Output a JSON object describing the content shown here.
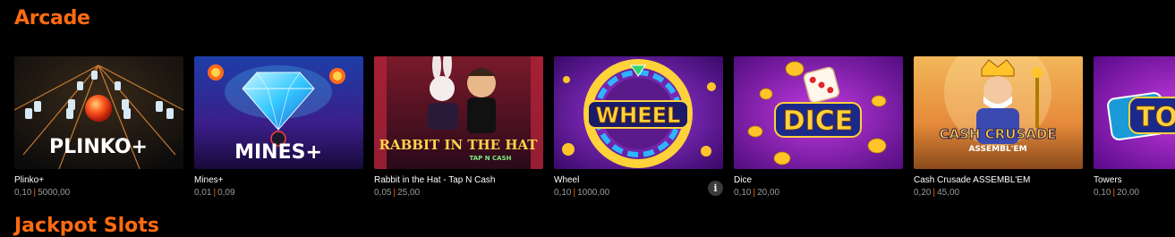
{
  "section": {
    "title": "Arcade"
  },
  "next_section": {
    "title": "Jackpot Slots"
  },
  "colors": {
    "accent": "#ff6b0f",
    "background": "#000000",
    "muted": "#9a9a9a"
  },
  "games": [
    {
      "title": "Plinko+",
      "min": "0,10",
      "max": "5000,00",
      "logo": "PLINKO+"
    },
    {
      "title": "Mines+",
      "min": "0,01",
      "max": "0,09",
      "logo": "MINES+"
    },
    {
      "title": "Rabbit in the Hat - Tap N Cash",
      "min": "0,05",
      "max": "25,00",
      "logo": "RABBIT IN THE HAT",
      "logo_sub": "TAP N CASH"
    },
    {
      "title": "Wheel",
      "min": "0,10",
      "max": "1000,00",
      "logo": "WHEEL",
      "info_icon": "i"
    },
    {
      "title": "Dice",
      "min": "0,10",
      "max": "20,00",
      "logo": "DICE"
    },
    {
      "title": "Cash Crusade ASSEMBL'EM",
      "min": "0,20",
      "max": "45,00",
      "logo": "CASH CRUSADE",
      "logo_sub": "ASSEMBL'EM"
    },
    {
      "title": "Towers",
      "min": "0,10",
      "max": "20,00",
      "logo": "TOW"
    }
  ]
}
